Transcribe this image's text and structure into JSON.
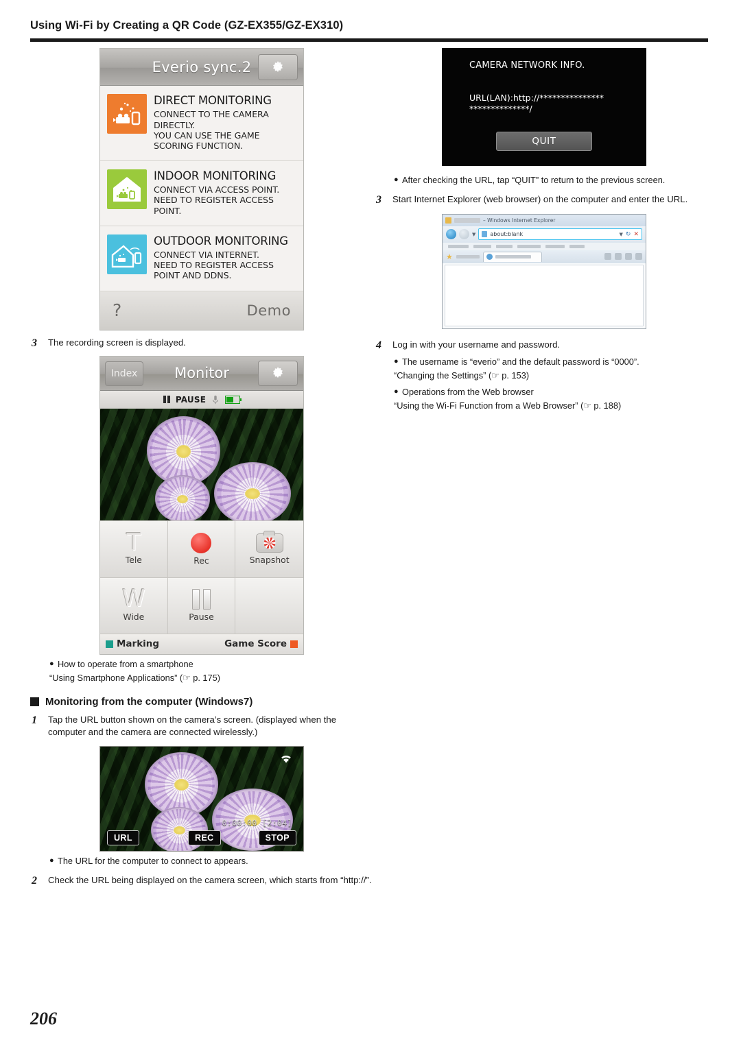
{
  "header": {
    "title": "Using Wi-Fi by Creating a QR Code (GZ-EX355/GZ-EX310)"
  },
  "page_number": "206",
  "everio_sync": {
    "app_title": "Everio sync.2",
    "gear_icon": "gear-icon",
    "items": [
      {
        "icon": "direct-monitoring-icon",
        "color": "#ee7c2e",
        "title": "DIRECT MONITORING",
        "desc": "CONNECT TO THE CAMERA DIRECTLY.\nYOU CAN USE THE GAME SCORING FUNCTION."
      },
      {
        "icon": "indoor-monitoring-icon",
        "color": "#9aca3c",
        "title": "INDOOR MONITORING",
        "desc": "CONNECT VIA ACCESS POINT.\nNEED TO REGISTER ACCESS POINT."
      },
      {
        "icon": "outdoor-monitoring-icon",
        "color": "#4bc0de",
        "title": "OUTDOOR MONITORING",
        "desc": "CONNECT VIA INTERNET.\nNEED TO REGISTER ACCESS POINT AND DDNS."
      }
    ],
    "help_label": "?",
    "demo_label": "Demo"
  },
  "step_recording": {
    "num": "3",
    "text": "The recording screen is displayed."
  },
  "monitor_screen": {
    "index_label": "Index",
    "title": "Monitor",
    "gear_icon": "gear-icon",
    "status_label": "PAUSE",
    "mic_icon": "microphone-icon",
    "battery_icon": "battery-icon",
    "buttons": [
      {
        "label": "Tele",
        "glyph": "T",
        "icon": "tele-icon"
      },
      {
        "label": "Rec",
        "glyph": "",
        "icon": "record-icon"
      },
      {
        "label": "Snapshot",
        "glyph": "",
        "icon": "snapshot-icon"
      },
      {
        "label": "Wide",
        "glyph": "W",
        "icon": "wide-icon"
      },
      {
        "label": "Pause",
        "glyph": "",
        "icon": "pause-icon"
      },
      {
        "label": "",
        "glyph": "",
        "icon": ""
      }
    ],
    "marking_label": "Marking",
    "marking_color": "#1b9e8c",
    "game_score_label": "Game Score",
    "game_score_color": "#ee5a24"
  },
  "notes_smartphone": {
    "bullet": "How to operate from a smartphone",
    "reference": "“Using Smartphone Applications” (☞ p. 175)"
  },
  "subheading": "Monitoring from the computer (Windows7)",
  "steps_left": [
    {
      "num": "1",
      "text": "Tap the URL button shown on the camera’s screen. (displayed when the computer and the camera are connected wirelessly.)"
    },
    {
      "num": "2",
      "text": "Check the URL being displayed on the camera screen, which starts from “http://”."
    }
  ],
  "bullet_url_appears": "The URL for the computer to connect to appears.",
  "camera_lcd": {
    "wifi_icon": "wifi-icon",
    "timecode": "0:00:00  [2:04]",
    "url_button": "URL",
    "rec_button": "REC",
    "stop_button": "STOP",
    "pause_icon": "pause-icon"
  },
  "camera_network_info": {
    "title": "CAMERA NETWORK INFO.",
    "url_line1": "URL(LAN):http://***************",
    "url_line2": "**************/",
    "quit_button": "QUIT"
  },
  "bullet_quit": "After checking the URL, tap “QUIT” to return to the previous screen.",
  "step_browser": {
    "num": "3",
    "text": "Start Internet Explorer (web browser) on the computer and enter the URL."
  },
  "browser": {
    "window_title": "– Windows Internet Explorer",
    "address_value": "about:blank",
    "favicon": "ie-icon",
    "back_icon": "back-arrow-icon",
    "forward_icon": "forward-arrow-icon",
    "refresh_icon": "refresh-icon",
    "stop_icon": "stop-icon"
  },
  "step_login": {
    "num": "4",
    "text": "Log in with your username and password."
  },
  "notes_login": [
    {
      "bullet": "The username is “everio” and the default password is “0000”.",
      "reference": "“Changing the Settings” (☞ p. 153)"
    },
    {
      "bullet": "Operations from the Web browser",
      "reference": "“Using the Wi-Fi Function from a Web Browser” (☞ p. 188)"
    }
  ]
}
